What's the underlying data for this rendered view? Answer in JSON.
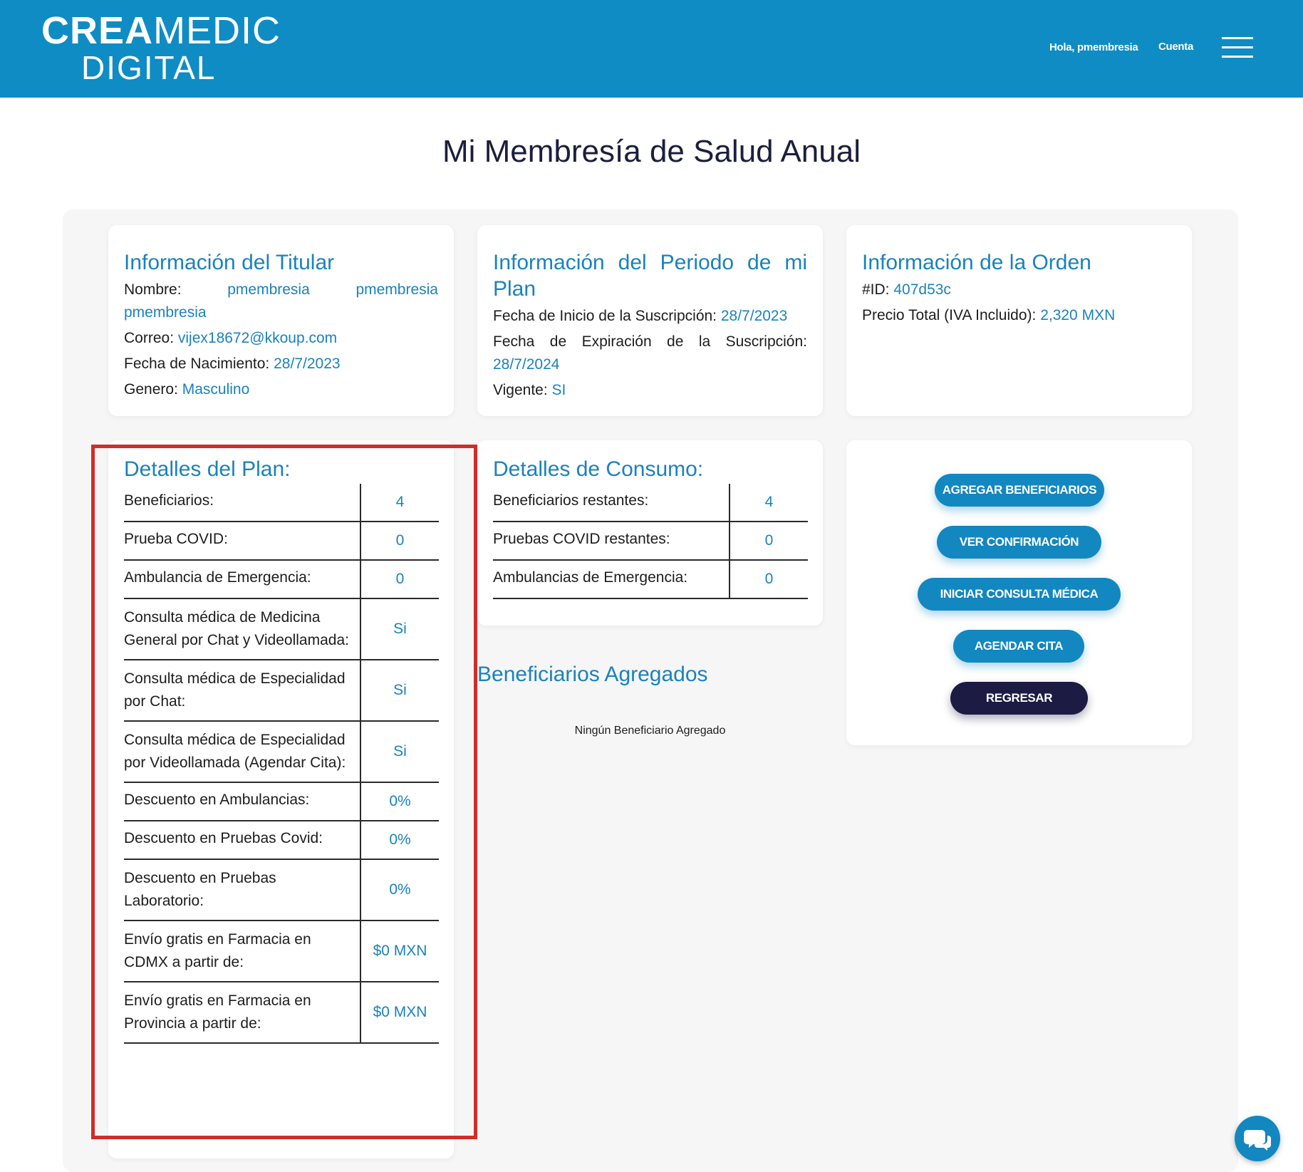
{
  "header": {
    "logo_top_bold": "CREA",
    "logo_top_light": "MEDIC",
    "logo_bottom": "DIGITAL",
    "greeting": "Hola, pmembresia",
    "account": "Cuenta"
  },
  "page_title": "Mi Membresía de Salud Anual",
  "holder": {
    "title": "Información del Titular",
    "name_label": "Nombre:",
    "name_value": "pmembresia pmembresia pmembresia",
    "email_label": "Correo:",
    "email_value": "vijex18672@kkoup.com",
    "birth_label": "Fecha de Nacimiento:",
    "birth_value": "28/7/2023",
    "gender_label": "Genero:",
    "gender_value": "Masculino"
  },
  "period": {
    "title": "Información del Periodo de mi Plan",
    "start_label": "Fecha de Inicio de la Suscripción:",
    "start_value": "28/7/2023",
    "expiry_label": "Fecha de Expiración de la Suscripción:",
    "expiry_value": "28/7/2024",
    "active_label": "Vigente:",
    "active_value": "SI"
  },
  "order": {
    "title": "Información de la Orden",
    "id_label": "#ID:",
    "id_value": "407d53c",
    "price_label": "Precio Total (IVA Incluido):",
    "price_value": "2,320 MXN"
  },
  "plan": {
    "title": "Detalles del Plan:",
    "rows": [
      {
        "label": "Beneficiarios:",
        "value": "4"
      },
      {
        "label": "Prueba COVID:",
        "value": "0"
      },
      {
        "label": "Ambulancia de Emergencia:",
        "value": "0"
      },
      {
        "label": "Consulta médica de Medicina General por Chat y Videollamada:",
        "value": "Si"
      },
      {
        "label": "Consulta médica de Especialidad por Chat:",
        "value": "Si"
      },
      {
        "label": "Consulta médica de Especialidad por Videollamada (Agendar Cita):",
        "value": "Si"
      },
      {
        "label": "Descuento en Ambulancias:",
        "value": "0%"
      },
      {
        "label": "Descuento en Pruebas Covid:",
        "value": "0%"
      },
      {
        "label": "Descuento en Pruebas Laboratorio:",
        "value": "0%"
      },
      {
        "label": "Envío gratis en Farmacia en CDMX a partir de:",
        "value": "$0 MXN"
      },
      {
        "label": "Envío gratis en Farmacia en Provincia a partir de:",
        "value": "$0 MXN"
      }
    ]
  },
  "consumption": {
    "title": "Detalles de Consumo:",
    "rows": [
      {
        "label": "Beneficiarios restantes:",
        "value": "4"
      },
      {
        "label": "Pruebas COVID restantes:",
        "value": "0"
      },
      {
        "label": "Ambulancias de Emergencia:",
        "value": "0"
      }
    ]
  },
  "beneficiaries": {
    "title": "Beneficiarios Agregados",
    "empty_text": "Ningún Beneficiario Agregado"
  },
  "actions": {
    "add_beneficiaries": "AGREGAR BENEFICIARIOS",
    "view_confirmation": "VER CONFIRMACIÓN",
    "start_consultation": "INICIAR CONSULTA MÉDICA",
    "schedule": "AGENDAR CITA",
    "back": "REGRESAR"
  },
  "colors": {
    "header_bg": "#0f8cc3",
    "accent": "#1a82bd",
    "dark_button": "#1b1b44",
    "highlight": "#d42b28"
  },
  "icons": {
    "menu": "hamburger-menu-icon",
    "chat": "chat-bubbles-icon"
  }
}
